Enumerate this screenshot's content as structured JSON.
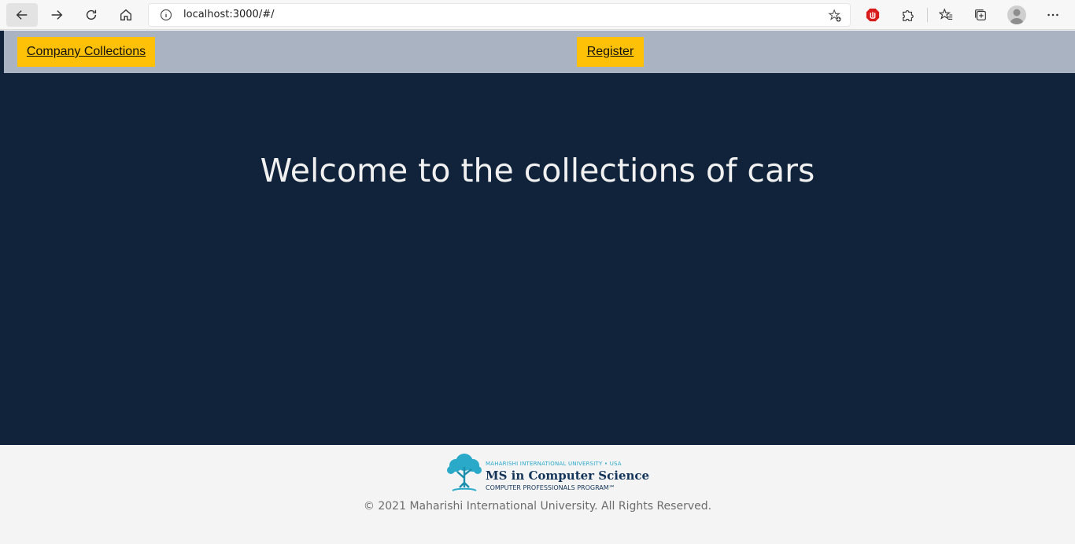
{
  "browser": {
    "url": "localhost:3000/#/",
    "icons": {
      "back": "back-arrow-icon",
      "forward": "forward-arrow-icon",
      "reload": "reload-icon",
      "home": "home-icon",
      "info": "info-icon",
      "favorite_add": "star-add-icon",
      "adblock": "adblock-icon",
      "extensions": "puzzle-icon",
      "favorites": "favorites-icon",
      "collections": "collections-icon",
      "profile": "profile-icon",
      "more": "more-icon"
    }
  },
  "nav": {
    "company_link": "Company Collections",
    "register_link": "Register",
    "button_color": "#ffc107",
    "bar_color": "#a9b3c1"
  },
  "hero": {
    "title": "Welcome to the collections of cars",
    "background": "#10233a"
  },
  "footer": {
    "logo_top": "MAHARISHI INTERNATIONAL UNIVERSITY • USA",
    "logo_main": "MS in Computer Science",
    "logo_sub": "COMPUTER PROFESSIONALS PROGRAM℠",
    "copyright": "© 2021 Maharishi International University. All Rights Reserved."
  }
}
